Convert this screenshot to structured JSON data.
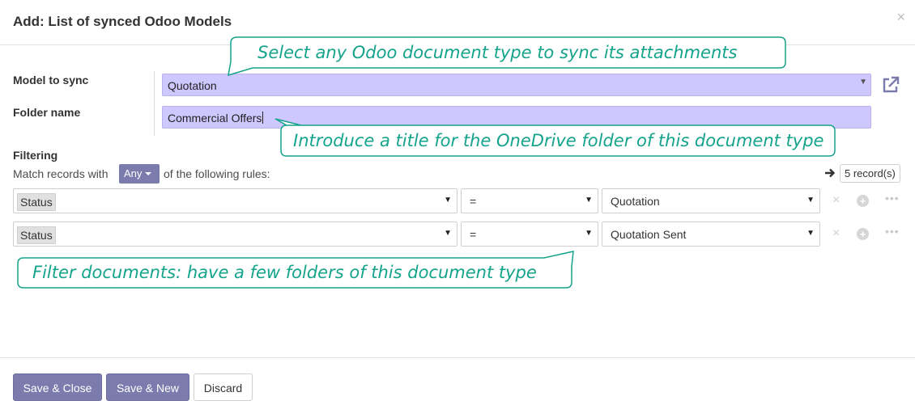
{
  "dialog": {
    "title": "Add: List of synced Odoo Models",
    "close_glyph": "×"
  },
  "form": {
    "model_label": "Model to sync",
    "model_value": "Quotation",
    "folder_label": "Folder name",
    "folder_value": "Commercial Offers"
  },
  "filtering": {
    "title": "Filtering",
    "match_prefix": "Match records with",
    "any_label": "Any",
    "match_suffix": "of the following rules:",
    "record_count": "5 record(s)",
    "rules": [
      {
        "field": "Status",
        "operator": "=",
        "value": "Quotation"
      },
      {
        "field": "Status",
        "operator": "=",
        "value": "Quotation Sent"
      }
    ]
  },
  "callouts": {
    "model": "Select any Odoo document type to sync its attachments",
    "folder": "Introduce a title for the OneDrive folder of this document type",
    "filter": "Filter documents: have a few folders of this document type"
  },
  "footer": {
    "save_close": "Save & Close",
    "save_new": "Save & New",
    "discard": "Discard"
  },
  "icons": {
    "close": "close-icon",
    "external_link": "external-link-icon",
    "arrow_right": "arrow-right-icon",
    "remove_rule": "remove-rule-icon",
    "add_rule": "add-rule-icon",
    "more": "ellipsis-icon"
  },
  "colors": {
    "primary": "#7c7bad",
    "required_field_bg": "#cec8ff",
    "callout": "#14a38b"
  }
}
